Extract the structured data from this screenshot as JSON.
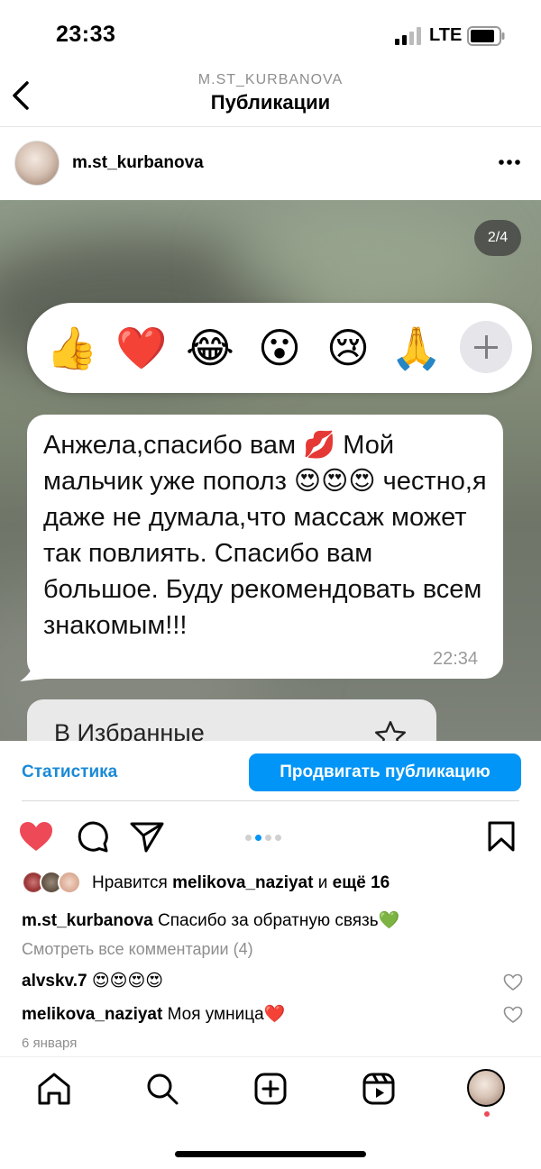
{
  "status_bar": {
    "time": "23:33",
    "network": "LTE"
  },
  "header": {
    "username": "M.ST_KURBANOVA",
    "title": "Публикации"
  },
  "post": {
    "author": "m.st_kurbanova",
    "image_counter": "2/4",
    "reactions": [
      "👍",
      "❤️",
      "😂",
      "😮",
      "😢",
      "🙏"
    ],
    "message_text": "Анжела,спасибо вам 💋 Мой мальчик уже пополз 😍😍😍 честно,я даже не думала,что массаж может так повлиять. Спасибо вам большое. Буду рекомендовать всем знакомым!!!",
    "message_time": "22:34",
    "favorites_label": "В Избранные",
    "stats_link": "Статистика",
    "promote_button": "Продвигать публикацию",
    "carousel": {
      "total": 4,
      "active_index": 1
    },
    "likes": {
      "prefix": "Нравится",
      "user": "melikova_naziyat",
      "joiner": "и",
      "rest": "ещё 16"
    },
    "caption": {
      "user": "m.st_kurbanova",
      "text": "Спасибо за обратную связь💚"
    },
    "view_all_comments": "Смотреть все комментарии (4)",
    "comments": [
      {
        "user": "alvskv.7",
        "text": "😍😍😍😍"
      },
      {
        "user": "melikova_naziyat",
        "text": "Моя умница❤️"
      }
    ],
    "date": "6 января"
  },
  "colors": {
    "accent": "#0095f6",
    "like": "#ed4956",
    "muted": "#8e8e8e"
  },
  "icons": [
    "back-icon",
    "more-icon",
    "heart-icon",
    "comment-icon",
    "share-icon",
    "bookmark-icon",
    "home-icon",
    "search-icon",
    "new-post-icon",
    "reels-icon"
  ]
}
